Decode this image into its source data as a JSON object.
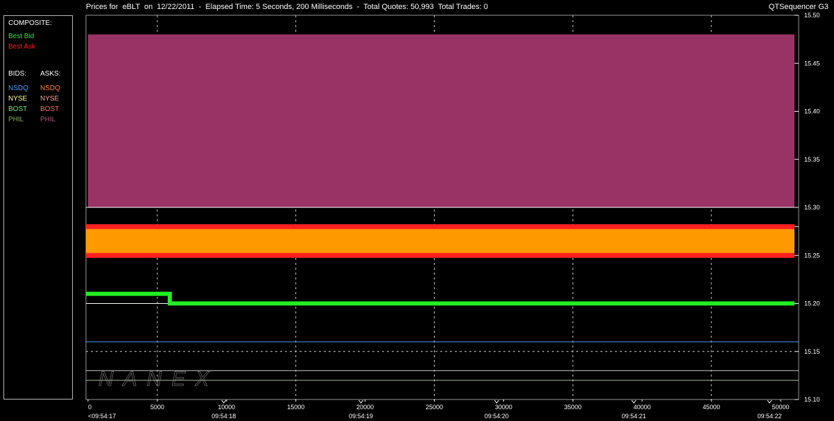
{
  "header": {
    "title": "Prices for  eBLT  on  12/22/2011  -  Elapsed Time: 5 Seconds, 200 Milliseconds  -  Total Quotes: 50,993  Total Trades: 0",
    "brand": "QTSequencer G3"
  },
  "legend": {
    "composite_label": "COMPOSITE:",
    "best_bid": "Best Bid",
    "best_ask": "Best Ask",
    "bids_label": "BIDS:",
    "asks_label": "ASKS:",
    "bids": [
      "NSDQ",
      "NYSE",
      "BOST",
      "PHIL"
    ],
    "asks": [
      "NSDQ",
      "NYSE",
      "BOST",
      "PHIL"
    ]
  },
  "colors": {
    "best_bid": "#22ee22",
    "best_ask": "#ff2020",
    "bid_nsdq": "#4a9eff",
    "bid_nyse": "#ffffa0",
    "bid_bost": "#80e080",
    "bid_phil": "#80b060",
    "ask_nsdq": "#ff8040",
    "ask_nyse": "#ffa0a0",
    "ask_bost": "#ff7060",
    "ask_phil": "#c05080",
    "phil_band": "#993366",
    "spread_band": "#ff9900"
  },
  "watermark": "NANEX",
  "chart_data": {
    "type": "area",
    "x_range": [
      0,
      51000
    ],
    "y_range": [
      15.1,
      15.5
    ],
    "x_ticks": [
      0,
      5000,
      10000,
      15000,
      20000,
      25000,
      30000,
      35000,
      40000,
      45000,
      50000
    ],
    "y_ticks": [
      "15.10",
      "15.15",
      "15.20",
      "15.25",
      "15.30",
      "15.35",
      "15.40",
      "15.45",
      "15.50"
    ],
    "time_labels": [
      {
        "x": 0,
        "label": "<09:54:17"
      },
      {
        "x": 9800,
        "label": "09:54:18"
      },
      {
        "x": 19700,
        "label": "09:54:19"
      },
      {
        "x": 29500,
        "label": "09:54:20"
      },
      {
        "x": 39400,
        "label": "09:54:21"
      },
      {
        "x": 49200,
        "label": "09:54:22"
      }
    ],
    "series": [
      {
        "name": "PHIL",
        "kind": "band",
        "y_low": 15.3,
        "y_high": 15.48,
        "x_start": 0,
        "x_end": 51000
      },
      {
        "name": "Best Ask",
        "kind": "line",
        "points": [
          [
            0,
            15.28
          ],
          [
            51000,
            15.28
          ]
        ]
      },
      {
        "name": "Best Bid",
        "kind": "line",
        "points": [
          [
            0,
            15.25
          ],
          [
            51000,
            15.25
          ]
        ]
      },
      {
        "name": "Best Bid",
        "kind": "line",
        "points": [
          [
            0,
            15.21
          ],
          [
            5900,
            15.21
          ],
          [
            5900,
            15.2
          ],
          [
            51000,
            15.2
          ]
        ]
      },
      {
        "name": "NSDQ",
        "kind": "level",
        "y": 15.16
      },
      {
        "name": "NYSE",
        "kind": "level",
        "y": 15.2
      },
      {
        "name": "BOST",
        "kind": "level",
        "y": 15.13
      },
      {
        "name": "PHIL",
        "kind": "level",
        "y": 15.12
      }
    ]
  }
}
